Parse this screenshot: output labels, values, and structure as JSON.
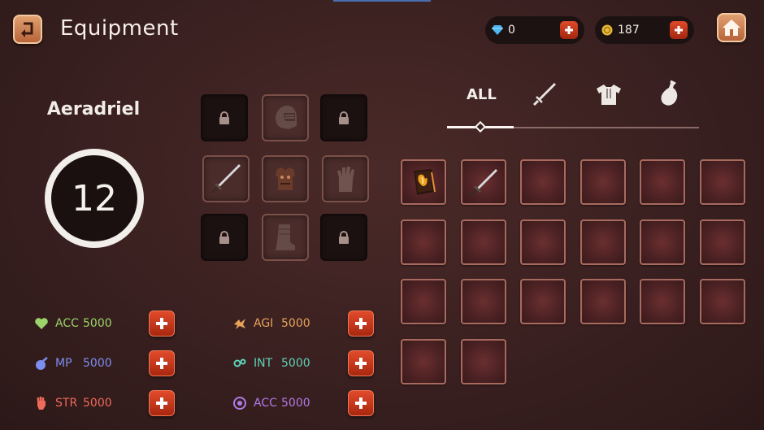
{
  "header": {
    "title": "Equipment",
    "gems": "0",
    "gold": "187"
  },
  "character": {
    "name": "Aeradriel",
    "level": "12"
  },
  "equipment_slots": [
    {
      "slot": "top-left",
      "state": "locked",
      "icon": "lock-icon"
    },
    {
      "slot": "helmet",
      "state": "empty",
      "icon": "helmet-icon"
    },
    {
      "slot": "top-right",
      "state": "locked",
      "icon": "lock-icon"
    },
    {
      "slot": "weapon",
      "state": "equipped",
      "icon": "sword-icon"
    },
    {
      "slot": "armor",
      "state": "equipped",
      "icon": "armor-icon"
    },
    {
      "slot": "gloves",
      "state": "empty",
      "icon": "glove-icon"
    },
    {
      "slot": "bottom-left",
      "state": "locked",
      "icon": "lock-icon"
    },
    {
      "slot": "boots",
      "state": "empty",
      "icon": "boot-icon"
    },
    {
      "slot": "bottom-right",
      "state": "locked",
      "icon": "lock-icon"
    }
  ],
  "tabs": {
    "all_label": "ALL",
    "icons": [
      "sword-icon",
      "shirt-icon",
      "potion-icon"
    ],
    "selected": "ALL"
  },
  "inventory": {
    "items": [
      "spellbook-icon",
      "sword-icon"
    ],
    "total_slots": 20
  },
  "stats": [
    {
      "name": "ACC",
      "value": "5000",
      "icon": "heart-icon",
      "color": "#9ad46a"
    },
    {
      "name": "AGI",
      "value": "5000",
      "icon": "agility-icon",
      "color": "#e8a25a"
    },
    {
      "name": "MP",
      "value": "5000",
      "icon": "mana-icon",
      "color": "#7c8ef0"
    },
    {
      "name": "INT",
      "value": "5000",
      "icon": "intellect-icon",
      "color": "#5fd1b8"
    },
    {
      "name": "STR",
      "value": "5000",
      "icon": "strength-icon",
      "color": "#ef6a5a"
    },
    {
      "name": "ACC",
      "value": "5000",
      "icon": "target-icon",
      "color": "#b07ae6"
    }
  ]
}
